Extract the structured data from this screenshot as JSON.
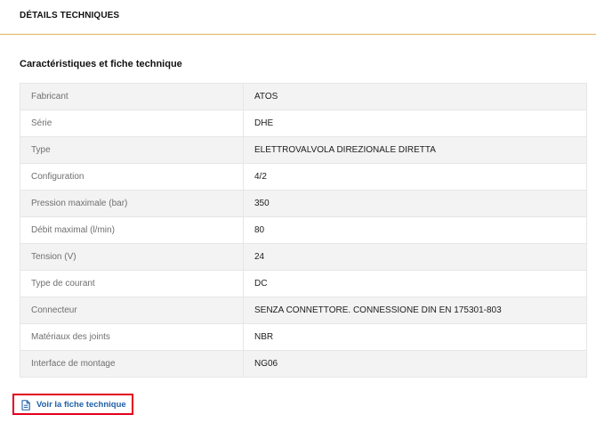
{
  "section": {
    "title": "DÉTAILS TECHNIQUES"
  },
  "specs": {
    "heading": "Caractéristiques et fiche technique",
    "rows": [
      {
        "label": "Fabricant",
        "value": "ATOS"
      },
      {
        "label": "Série",
        "value": "DHE"
      },
      {
        "label": "Type",
        "value": "ELETTROVALVOLA DIREZIONALE DIRETTA"
      },
      {
        "label": "Configuration",
        "value": "4/2"
      },
      {
        "label": "Pression maximale (bar)",
        "value": "350"
      },
      {
        "label": "Débit maximal (l/min)",
        "value": "80"
      },
      {
        "label": "Tension (V)",
        "value": "24"
      },
      {
        "label": "Type de courant",
        "value": "DC"
      },
      {
        "label": "Connecteur",
        "value": "SENZA CONNETTORE. CONNESSIONE DIN EN 175301-803"
      },
      {
        "label": "Matériaux des joints",
        "value": "NBR"
      },
      {
        "label": "Interface de montage",
        "value": "NG06"
      }
    ]
  },
  "datasheet_link": {
    "label": "Voir la fiche technique",
    "icon": "document-icon"
  },
  "colors": {
    "accent_line": "#e3b45b",
    "link_text": "#1f5fa8",
    "highlight_border": "#e3001b",
    "row_stripe": "#f3f3f3"
  }
}
